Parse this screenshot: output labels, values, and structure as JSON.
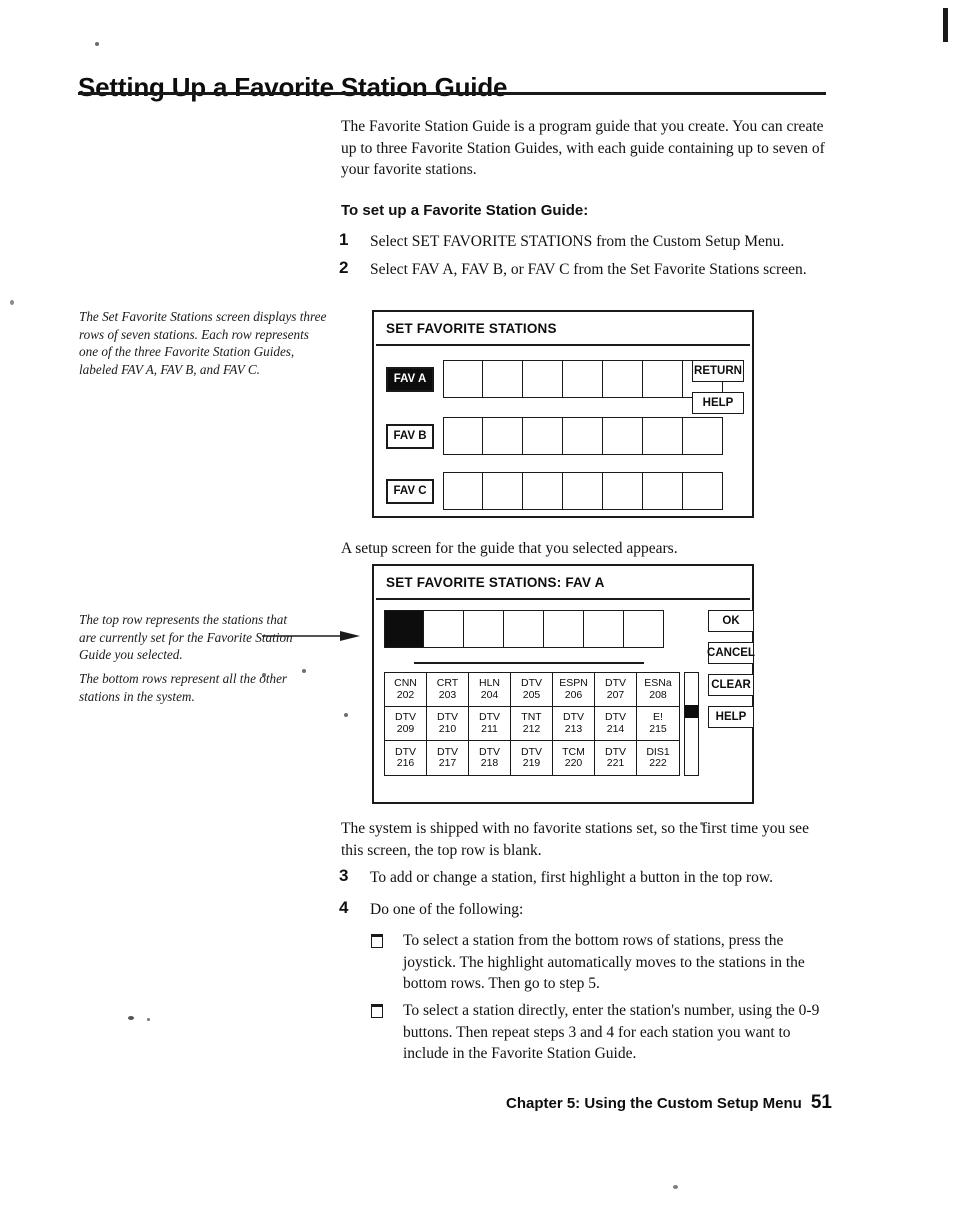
{
  "document": {
    "title": "Setting Up a Favorite Station Guide",
    "intro": "The Favorite Station Guide is a program guide that you create. You can create up to three Favorite Station Guides, with each guide containing up to seven of your favorite stations.",
    "subhead": "To set up a Favorite Station Guide:",
    "steps": [
      {
        "num": "1",
        "text": "Select SET FAVORITE STATIONS from the Custom Setup Menu."
      },
      {
        "num": "2",
        "text": "Select FAV A, FAV B, or FAV C from the Set Favorite Stations screen."
      },
      {
        "num": "3",
        "text": "To add or change a station, first highlight a button in the top row."
      },
      {
        "num": "4",
        "text": "Do one of the following:"
      }
    ],
    "caption_after_first_screen": "A setup screen for the guide that you selected appears.",
    "paragraph_after_second_screen": "The system is shipped with no favorite stations set, so the first time you see this screen, the top row is blank.",
    "bullets": [
      "To select a station from the bottom rows of stations, press the joystick. The highlight automatically moves to the stations in the bottom rows. Then go to step 5.",
      "To select a station directly, enter the station's number, using the 0-9 buttons. Then repeat steps 3 and 4 for each station you want to include in the Favorite Station Guide."
    ],
    "footer": {
      "chapter": "Chapter 5: Using the Custom Setup Menu",
      "page": "51"
    }
  },
  "margin_notes": [
    {
      "id": "note-fav-rows",
      "text": "The Set Favorite Stations screen displays three rows of seven stations. Each row represents one of the three Favorite Station Guides, labeled FAV A, FAV B, and FAV C."
    },
    {
      "id": "note-top-row",
      "text": "The top row represents the stations that are currently set for the Favorite Station Guide you selected."
    },
    {
      "id": "note-bottom-rows",
      "text": "The bottom rows represent all the other stations in the system."
    }
  ],
  "screen_one": {
    "title": "SET FAVORITE STATIONS",
    "rows": [
      {
        "label": "FAV A",
        "selected": true,
        "cells": [
          "",
          "",
          "",
          "",
          "",
          "",
          ""
        ]
      },
      {
        "label": "FAV B",
        "selected": false,
        "cells": [
          "",
          "",
          "",
          "",
          "",
          "",
          ""
        ]
      },
      {
        "label": "FAV C",
        "selected": false,
        "cells": [
          "",
          "",
          "",
          "",
          "",
          "",
          ""
        ]
      }
    ],
    "buttons": [
      {
        "label": "RETURN"
      },
      {
        "label": "HELP"
      }
    ]
  },
  "screen_two": {
    "title": "SET FAVORITE STATIONS: FAV A",
    "top_row": [
      {
        "filled": true
      },
      {
        "filled": false
      },
      {
        "filled": false
      },
      {
        "filled": false
      },
      {
        "filled": false
      },
      {
        "filled": false
      },
      {
        "filled": false
      }
    ],
    "station_grid": [
      {
        "name": "CNN",
        "number": "202"
      },
      {
        "name": "CRT",
        "number": "203"
      },
      {
        "name": "HLN",
        "number": "204"
      },
      {
        "name": "DTV",
        "number": "205"
      },
      {
        "name": "ESPN",
        "number": "206"
      },
      {
        "name": "DTV",
        "number": "207"
      },
      {
        "name": "ESNa",
        "number": "208"
      },
      {
        "name": "DTV",
        "number": "209"
      },
      {
        "name": "DTV",
        "number": "210"
      },
      {
        "name": "DTV",
        "number": "211"
      },
      {
        "name": "TNT",
        "number": "212"
      },
      {
        "name": "DTV",
        "number": "213"
      },
      {
        "name": "DTV",
        "number": "214"
      },
      {
        "name": "E!",
        "number": "215"
      },
      {
        "name": "DTV",
        "number": "216"
      },
      {
        "name": "DTV",
        "number": "217"
      },
      {
        "name": "DTV",
        "number": "218"
      },
      {
        "name": "DTV",
        "number": "219"
      },
      {
        "name": "TCM",
        "number": "220"
      },
      {
        "name": "DTV",
        "number": "221"
      },
      {
        "name": "DIS1",
        "number": "222"
      }
    ],
    "buttons": [
      {
        "label": "OK"
      },
      {
        "label": "CANCEL"
      },
      {
        "label": "CLEAR"
      },
      {
        "label": "HELP"
      }
    ]
  },
  "colors": {
    "ink": "#111111",
    "highlight_fill": "#0d0d0d",
    "highlight_text": "#ffffff",
    "paper": "#ffffff"
  }
}
